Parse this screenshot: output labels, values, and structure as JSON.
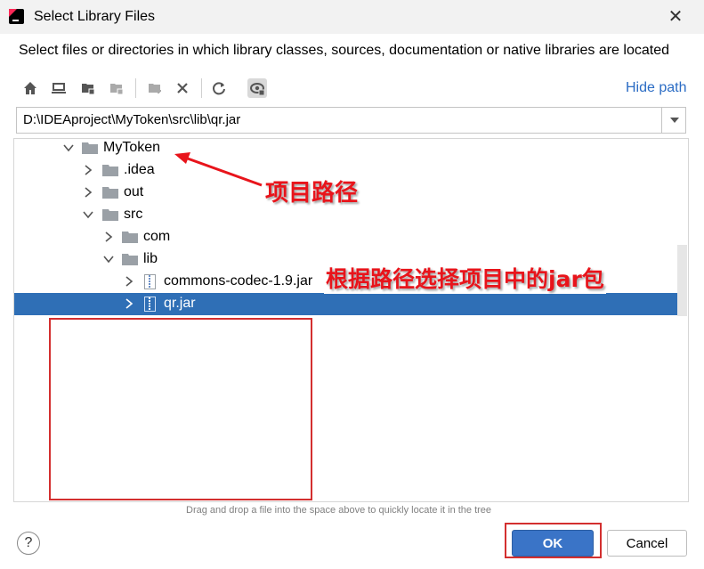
{
  "window": {
    "title": "Select Library Files"
  },
  "description": "Select files or directories in which library classes, sources, documentation or native libraries are located",
  "toolbar": {
    "icons": [
      "home-icon",
      "desktop-icon",
      "project-folder-icon",
      "module-folder-icon",
      "new-folder-icon",
      "delete-icon",
      "refresh-icon",
      "show-hidden-icon"
    ],
    "hide_path": "Hide path"
  },
  "path": {
    "value": "D:\\IDEAproject\\MyToken\\src\\lib\\qr.jar"
  },
  "tree": {
    "items": [
      {
        "label": "MyToken",
        "expanded": true,
        "type": "folder"
      },
      {
        "label": ".idea",
        "expanded": false,
        "type": "folder"
      },
      {
        "label": "out",
        "expanded": false,
        "type": "folder"
      },
      {
        "label": "src",
        "expanded": true,
        "type": "folder"
      },
      {
        "label": "com",
        "expanded": false,
        "type": "folder"
      },
      {
        "label": "lib",
        "expanded": true,
        "type": "folder"
      },
      {
        "label": "commons-codec-1.9.jar",
        "expanded": false,
        "type": "jar"
      },
      {
        "label": "qr.jar",
        "expanded": false,
        "type": "jar",
        "selected": true
      }
    ]
  },
  "hint": "Drag and drop a file into the space above to quickly locate it in the tree",
  "buttons": {
    "ok": "OK",
    "cancel": "Cancel",
    "help": "?"
  },
  "annotations": {
    "project_path": "项目路径",
    "select_jar": "根据路径选择项目中的jar包"
  },
  "colors": {
    "accent": "#3a74c7",
    "selection": "#2f6fb6",
    "annotation": "#e8141b",
    "link": "#2b6cc4"
  }
}
